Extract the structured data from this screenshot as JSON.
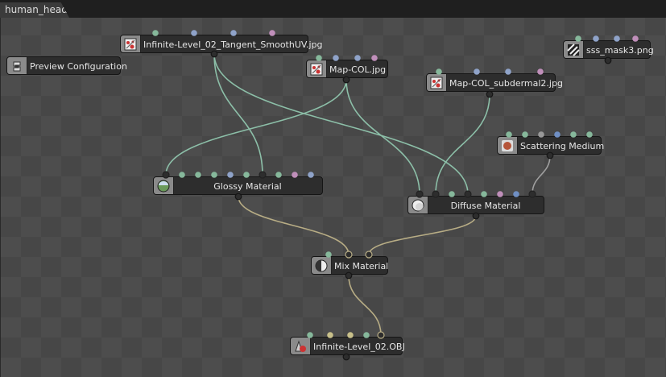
{
  "tab": {
    "label": "human_head"
  },
  "colors": {
    "green": "#86b89b",
    "blue": "#8fa3c9",
    "pink": "#c08fba",
    "blue2": "#6f8fc4",
    "grey": "#999999",
    "link_texture": "#8cbfa8",
    "link_material": "#b8ad85"
  },
  "nodes": {
    "tex_tangent": {
      "label": "Infinite-Level_02_Tangent_SmoothUV.jpg",
      "icon": "image-texture-icon"
    },
    "preview": {
      "label": "Preview Configuration",
      "icon": "preview-config-icon"
    },
    "map_col": {
      "label": "Map-COL.jpg",
      "icon": "image-texture-icon"
    },
    "map_sub": {
      "label": "Map-COL_subdermal2.jpg",
      "icon": "image-texture-icon"
    },
    "sss_mask": {
      "label": "sss_mask3.png",
      "icon": "alpha-texture-icon"
    },
    "scatter": {
      "label": "Scattering Medium",
      "icon": "medium-icon"
    },
    "glossy": {
      "label": "Glossy Material",
      "icon": "glossy-sphere-icon"
    },
    "diffuse": {
      "label": "Diffuse Material",
      "icon": "diffuse-sphere-icon"
    },
    "mix": {
      "label": "Mix Material",
      "icon": "mix-material-icon"
    },
    "mesh": {
      "label": "Infinite-Level_02.OBJ",
      "icon": "mesh-icon"
    }
  }
}
